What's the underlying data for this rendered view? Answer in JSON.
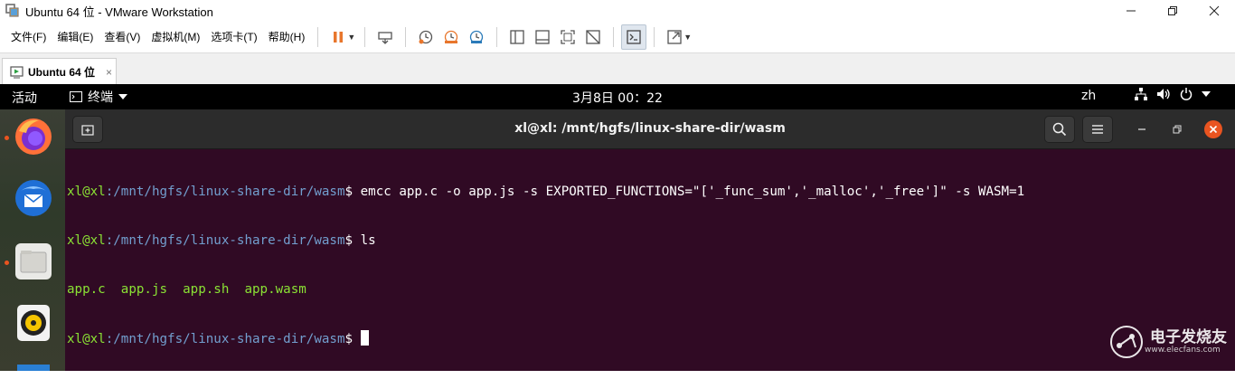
{
  "window": {
    "title": "Ubuntu 64 位 - VMware Workstation",
    "controls": [
      "minimize",
      "restore",
      "close"
    ]
  },
  "menu": {
    "items": [
      {
        "label": "文件(F)"
      },
      {
        "label": "编辑(E)"
      },
      {
        "label": "查看(V)"
      },
      {
        "label": "虚拟机(M)"
      },
      {
        "label": "选项卡(T)"
      },
      {
        "label": "帮助(H)"
      }
    ]
  },
  "toolbar": {
    "icons": [
      "pause-icon",
      "send-ctrl-alt-del-icon",
      "snapshot-icon",
      "revert-snapshot-icon",
      "snapshot-manager-icon",
      "show-library-icon",
      "thumbnail-bar-icon",
      "full-screen-icon",
      "unity-icon",
      "console-view-icon",
      "stretch-icon"
    ],
    "accent": "#e8762c"
  },
  "tabs": [
    {
      "label": "Ubuntu 64 位",
      "close": "×"
    }
  ],
  "gnome": {
    "activities": "活动",
    "app_menu": "终端",
    "clock": "3月8日  00：22",
    "input_method": "zh"
  },
  "dock": {
    "apps": [
      "firefox-icon",
      "thunderbird-icon",
      "files-icon",
      "rhythmbox-icon"
    ]
  },
  "terminal": {
    "title": "xl@xl: /mnt/hgfs/linux-share-dir/wasm",
    "background": "#300a24",
    "lines": [
      {
        "user": "xl@xl",
        "path": ":/mnt/hgfs/linux-share-dir/wasm",
        "prompt": "$ ",
        "cmd": "emcc app.c -o app.js -s EXPORTED_FUNCTIONS=\"['_func_sum','_malloc','_free']\" -s WASM=1"
      },
      {
        "user": "xl@xl",
        "path": ":/mnt/hgfs/linux-share-dir/wasm",
        "prompt": "$ ",
        "cmd": "ls"
      },
      {
        "output": "app.c  app.js  app.sh  app.wasm"
      },
      {
        "user": "xl@xl",
        "path": ":/mnt/hgfs/linux-share-dir/wasm",
        "prompt": "$ ",
        "cmd": ""
      }
    ]
  },
  "watermark": {
    "text": "电子发烧友",
    "sub": "www.elecfans.com"
  }
}
